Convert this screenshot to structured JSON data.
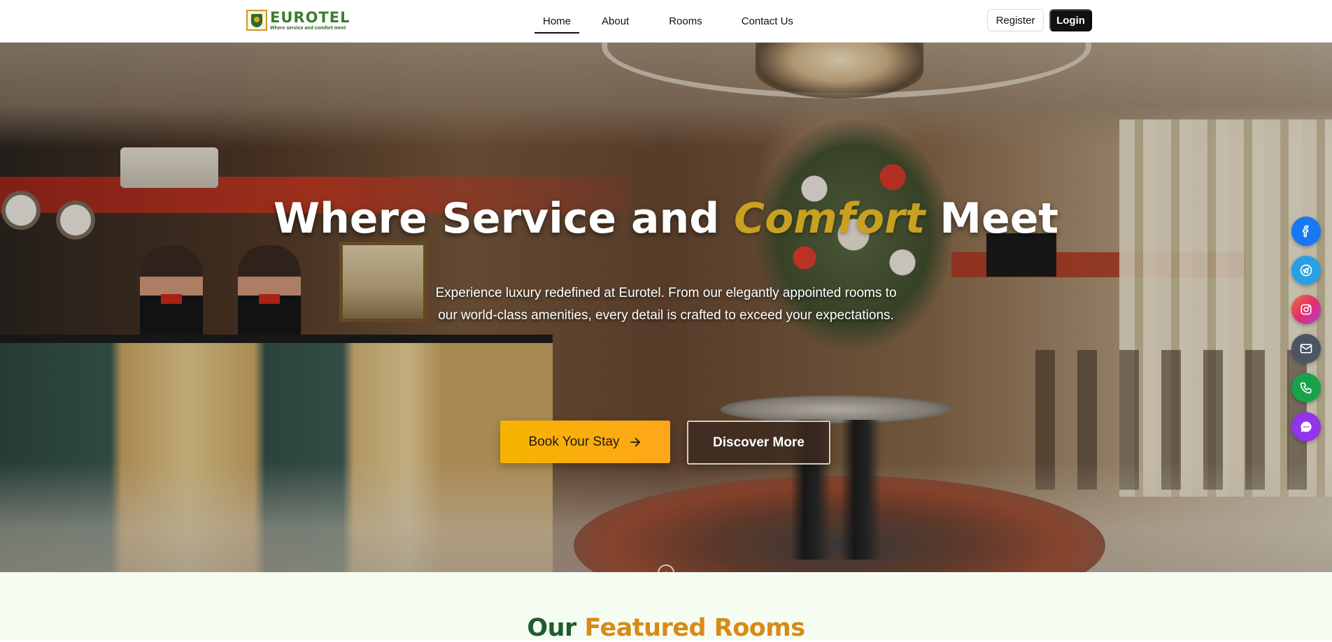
{
  "brand": {
    "name": "EUROTEL",
    "tagline": "Where service and comfort meet",
    "accent_color": "#3c7d2f",
    "gold_color": "#c9a020"
  },
  "nav": {
    "items": [
      {
        "label": "Home",
        "active": true
      },
      {
        "label": "About",
        "active": false
      },
      {
        "label": "Rooms",
        "active": false
      },
      {
        "label": "Contact Us",
        "active": false
      }
    ]
  },
  "auth": {
    "register_label": "Register",
    "login_label": "Login"
  },
  "hero": {
    "title_before": "Where Service and ",
    "title_accent": "Comfort",
    "title_after": " Meet",
    "subtitle": "Experience luxury redefined at Eurotel. From our elegantly appointed rooms to our world-class amenities, every detail is crafted to exceed your expectations.",
    "primary_button": "Book Your Stay",
    "primary_button_icon": "arrow-right-icon",
    "secondary_button": "Discover More",
    "carousel": {
      "slide_count": 3,
      "active_index": 0
    }
  },
  "social": [
    {
      "name": "facebook-icon",
      "color": "#1877f2"
    },
    {
      "name": "telegram-icon",
      "color": "#2aa0e2"
    },
    {
      "name": "instagram-icon",
      "color": "#e1306c"
    },
    {
      "name": "email-icon",
      "color": "#4b5563"
    },
    {
      "name": "phone-icon",
      "color": "#16a34a"
    },
    {
      "name": "chat-icon",
      "color": "#9333ea"
    }
  ],
  "featured": {
    "title_part1": "Our",
    "title_part2": "Featured Rooms"
  }
}
